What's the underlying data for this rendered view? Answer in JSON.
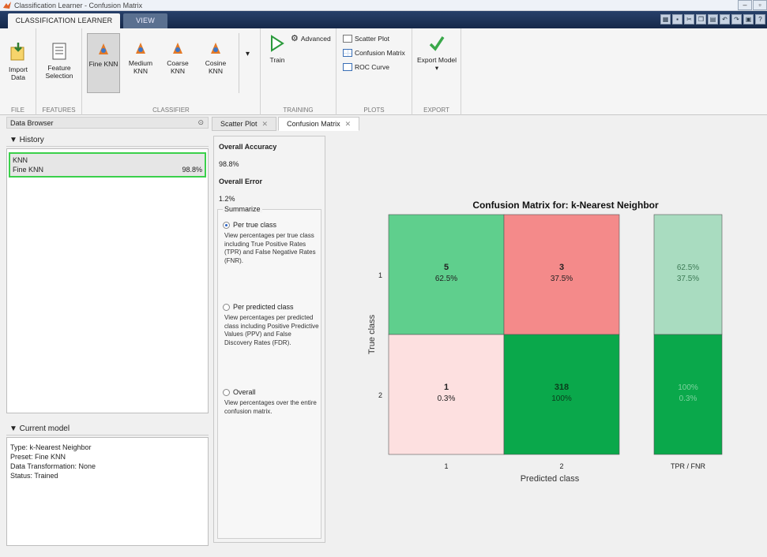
{
  "window": {
    "title": "Classification Learner - Confusion Matrix",
    "minimize_glyph": "–",
    "restore_glyph": "▫"
  },
  "ribbon_tabs": {
    "active": "CLASSIFICATION LEARNER",
    "inactive": "VIEW"
  },
  "ribbon": {
    "file": {
      "import_label": "Import\nData",
      "group": "FILE"
    },
    "features": {
      "feature_selection_label": "Feature\nSelection",
      "group": "FEATURES"
    },
    "classifier": {
      "items": [
        "Fine KNN",
        "Medium KNN",
        "Coarse KNN",
        "Cosine KNN"
      ],
      "selected": "Fine KNN",
      "more_glyph": "▾",
      "group": "CLASSIFIER"
    },
    "training": {
      "train_label": "Train",
      "advanced_label": "Advanced",
      "group": "TRAINING"
    },
    "plots": {
      "items": [
        "Scatter Plot",
        "Confusion Matrix",
        "ROC Curve"
      ],
      "group": "PLOTS"
    },
    "export": {
      "export_label": "Export Model",
      "export_arrow": "▾",
      "group": "EXPORT"
    }
  },
  "data_browser": {
    "header": "Data Browser",
    "collapse_glyph": "⊙"
  },
  "history": {
    "header": "▼ History",
    "item_type": "KNN",
    "item_name": "Fine KNN",
    "item_score": "98.8%"
  },
  "current_model": {
    "header": "▼ Current model",
    "lines": [
      "Type: k-Nearest Neighbor",
      "Preset: Fine KNN",
      "Data Transformation: None",
      "Status: Trained"
    ]
  },
  "doc_tabs": {
    "scatter": "Scatter Plot",
    "confusion": "Confusion Matrix",
    "close_glyph": "✕"
  },
  "options": {
    "overall_accuracy_label": "Overall Accuracy",
    "overall_accuracy_value": "98.8%",
    "overall_error_label": "Overall Error",
    "overall_error_value": "1.2%",
    "summarize_label": "Summarize",
    "per_true": {
      "label": "Per true class",
      "desc": "View percentages per true class including True Positive Rates (TPR) and False Negative Rates (FNR)."
    },
    "per_predicted": {
      "label": "Per predicted class",
      "desc": "View percentages per predicted class including Positive Predictive Values (PPV) and False Discovery Rates (FDR)."
    },
    "overall": {
      "label": "Overall",
      "desc": "View percentages over the entire confusion matrix."
    }
  },
  "chart_data": {
    "type": "heatmap",
    "title": "Confusion Matrix for: k-Nearest Neighbor",
    "xlabel": "Predicted class",
    "ylabel": "True class",
    "row_labels": [
      "1",
      "2"
    ],
    "col_labels": [
      "1",
      "2"
    ],
    "cells": [
      [
        {
          "count": "5",
          "pct": "62.5%",
          "color": "#5fcf8d"
        },
        {
          "count": "3",
          "pct": "37.5%",
          "color": "#f48a8a"
        }
      ],
      [
        {
          "count": "1",
          "pct": "0.3%",
          "color": "#fde0e0"
        },
        {
          "count": "318",
          "pct": "100%",
          "color": "#0aa84b"
        }
      ]
    ],
    "rate_column": {
      "label": "TPR / FNR",
      "rows": [
        {
          "tpr": "62.5%",
          "fnr": "37.5%",
          "color": "#a9dcc0"
        },
        {
          "tpr": "100%",
          "fnr": "0.3%",
          "color": "#0aa84b"
        }
      ]
    }
  }
}
